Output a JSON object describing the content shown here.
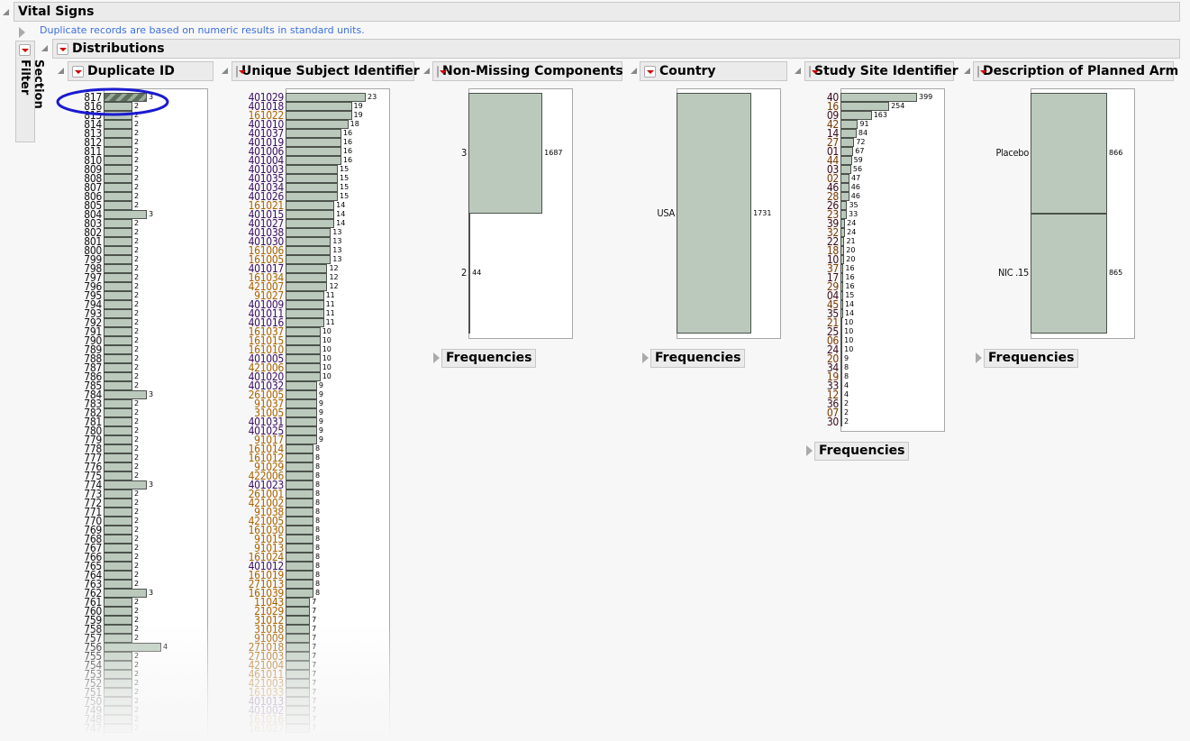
{
  "report": {
    "title": "Vital Signs",
    "note": "Duplicate records are based on numeric results in standard units.",
    "section_filter_label": "Section Filter",
    "distributions_title": "Distributions",
    "frequencies_label": "Frequencies"
  },
  "colors": {
    "bar_fill": "#bac9bb",
    "bar_stroke": "#4d524d",
    "note": "#3c6fe0",
    "highlight_ellipse": "#1a1ad0"
  },
  "chart_data": [
    {
      "type": "bar",
      "title": "Duplicate ID",
      "orientation": "horizontal",
      "categories": [
        "817",
        "816",
        "815",
        "814",
        "813",
        "812",
        "811",
        "810",
        "809",
        "808",
        "807",
        "806",
        "805",
        "804",
        "803",
        "802",
        "801",
        "800",
        "799",
        "798",
        "797",
        "796",
        "795",
        "794",
        "793",
        "792",
        "791",
        "790",
        "789",
        "788",
        "787",
        "786",
        "785",
        "784",
        "783",
        "782",
        "781",
        "780",
        "779",
        "778",
        "777",
        "776",
        "775",
        "774",
        "773",
        "772",
        "771",
        "770",
        "769",
        "768",
        "767",
        "766",
        "765",
        "764",
        "763",
        "762",
        "761",
        "760",
        "759",
        "758",
        "757",
        "756",
        "755",
        "754",
        "753",
        "752",
        "751",
        "750",
        "749",
        "748",
        "747"
      ],
      "values": [
        3,
        2,
        2,
        2,
        2,
        2,
        2,
        2,
        2,
        2,
        2,
        2,
        2,
        3,
        2,
        2,
        2,
        2,
        2,
        2,
        2,
        2,
        2,
        2,
        2,
        2,
        2,
        2,
        2,
        2,
        2,
        2,
        2,
        3,
        2,
        2,
        2,
        2,
        2,
        2,
        2,
        2,
        2,
        3,
        2,
        2,
        2,
        2,
        2,
        2,
        2,
        2,
        2,
        2,
        2,
        3,
        2,
        2,
        2,
        2,
        2,
        4,
        2,
        2,
        2,
        2,
        2,
        2,
        2,
        2,
        2
      ],
      "selected": "817"
    },
    {
      "type": "bar",
      "title": "Unique Subject Identifier",
      "orientation": "horizontal",
      "categories": [
        "401029",
        "401018",
        "161022",
        "401010",
        "401037",
        "401019",
        "401006",
        "401004",
        "401003",
        "401035",
        "401034",
        "401026",
        "161021",
        "401015",
        "401027",
        "401038",
        "401030",
        "161006",
        "161005",
        "401017",
        "161034",
        "421007",
        "91027",
        "401009",
        "401011",
        "401016",
        "161037",
        "161015",
        "161010",
        "401005",
        "421006",
        "401020",
        "401032",
        "261005",
        "91037",
        "31005",
        "401031",
        "401025",
        "91017",
        "161014",
        "161012",
        "91029",
        "422006",
        "401023",
        "261001",
        "421002",
        "91038",
        "421005",
        "161030",
        "91015",
        "91013",
        "161024",
        "401012",
        "161019",
        "271013",
        "161039",
        "11043",
        "21029",
        "31012",
        "31018",
        "91009",
        "271018",
        "271003",
        "421004",
        "461011",
        "421003",
        "161033",
        "401013",
        "401002",
        "161016",
        "161027"
      ],
      "values": [
        23,
        19,
        19,
        18,
        16,
        16,
        16,
        16,
        15,
        15,
        15,
        15,
        14,
        14,
        14,
        13,
        13,
        13,
        13,
        12,
        12,
        12,
        11,
        11,
        11,
        11,
        10,
        10,
        10,
        10,
        10,
        10,
        9,
        9,
        9,
        9,
        9,
        9,
        9,
        8,
        8,
        8,
        8,
        8,
        8,
        8,
        8,
        8,
        8,
        8,
        8,
        8,
        8,
        8,
        8,
        8,
        7,
        7,
        7,
        7,
        7,
        7,
        7,
        7,
        7,
        7,
        7,
        7,
        7,
        7,
        7
      ]
    },
    {
      "type": "bar",
      "title": "Non-Missing Components",
      "orientation": "horizontal",
      "categories": [
        "3",
        "2"
      ],
      "values": [
        1687,
        44
      ]
    },
    {
      "type": "bar",
      "title": "Country",
      "orientation": "horizontal",
      "categories": [
        "USA"
      ],
      "values": [
        1731
      ]
    },
    {
      "type": "bar",
      "title": "Study Site Identifier",
      "orientation": "horizontal",
      "categories": [
        "40",
        "16",
        "09",
        "42",
        "14",
        "27",
        "01",
        "44",
        "03",
        "02",
        "46",
        "28",
        "26",
        "23",
        "39",
        "32",
        "22",
        "18",
        "10",
        "37",
        "17",
        "29",
        "04",
        "45",
        "35",
        "21",
        "25",
        "06",
        "24",
        "20",
        "34",
        "19",
        "33",
        "12",
        "36",
        "07",
        "30"
      ],
      "values": [
        399,
        254,
        163,
        91,
        84,
        72,
        67,
        59,
        56,
        47,
        46,
        46,
        35,
        33,
        24,
        24,
        21,
        20,
        20,
        16,
        16,
        16,
        15,
        14,
        14,
        10,
        10,
        10,
        10,
        9,
        8,
        8,
        4,
        4,
        2,
        2,
        2
      ]
    },
    {
      "type": "bar",
      "title": "Description of Planned Arm",
      "orientation": "horizontal",
      "categories": [
        "Placebo",
        "NIC .15"
      ],
      "values": [
        866,
        865
      ]
    }
  ]
}
